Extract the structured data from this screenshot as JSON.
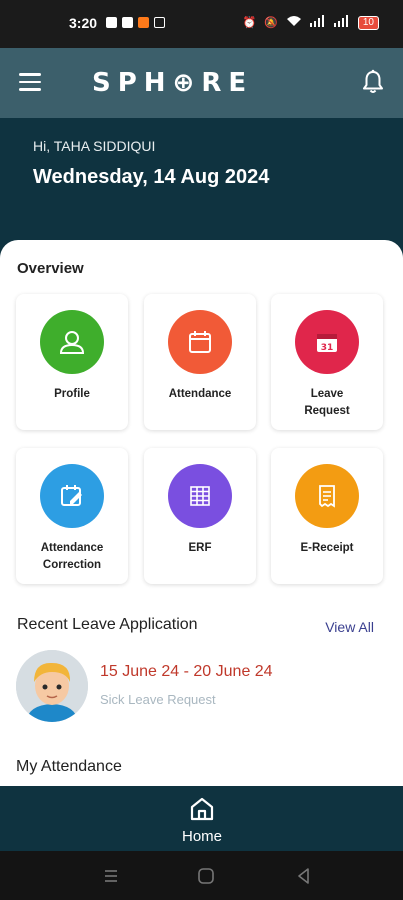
{
  "status_bar": {
    "time": "3:20",
    "battery": "10",
    "left_icons": [
      "facebook-icon",
      "youtube-icon",
      "app-icon",
      "instagram-icon"
    ],
    "right_icons": [
      "alarm-icon",
      "mute-icon",
      "wifi-icon",
      "signal-icon",
      "signal-icon",
      "battery-icon"
    ]
  },
  "header": {
    "logo": "SPH⊕RE",
    "menu_icon": "hamburger-menu-icon",
    "notification_icon": "bell-icon"
  },
  "greeting": {
    "hello": "Hi, TAHA SIDDIQUI",
    "date": "Wednesday, 14 Aug 2024"
  },
  "overview": {
    "title": "Overview",
    "tiles": [
      {
        "label": "Profile",
        "color": "#3fae2c",
        "icon": "user-icon"
      },
      {
        "label": "Attendance",
        "color": "#f15a37",
        "icon": "calendar-icon"
      },
      {
        "label": "Leave\nRequest",
        "color": "#e0264b",
        "icon": "calendar-31-icon"
      },
      {
        "label": "Attendance\nCorrection",
        "color": "#2d9ee3",
        "icon": "calendar-edit-icon"
      },
      {
        "label": "ERF",
        "color": "#7a4fe0",
        "icon": "list-icon"
      },
      {
        "label": "E-Receipt",
        "color": "#f39c12",
        "icon": "receipt-icon"
      }
    ]
  },
  "recent_leave": {
    "title": "Recent Leave Application",
    "view_all": "View All",
    "item": {
      "dates": "15 June 24 - 20 June 24",
      "type": "Sick Leave Request"
    }
  },
  "my_attendance": {
    "title": "My Attendance"
  },
  "bottom_nav": {
    "home_label": "Home"
  },
  "colors": {
    "primary_dark": "#0f3340",
    "header": "#3c5f6b",
    "leave_dates": "#c0392b",
    "view_all": "#3a3f8f"
  }
}
